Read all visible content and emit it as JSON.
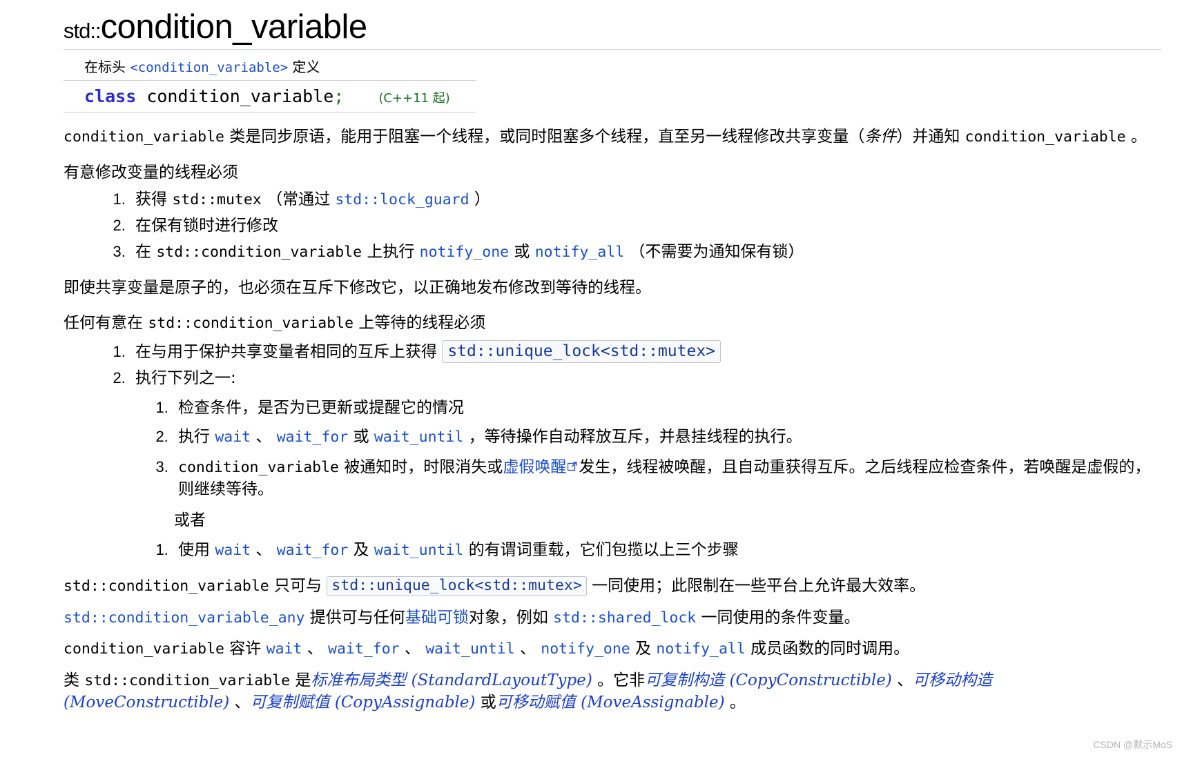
{
  "page": {
    "title_namespace": "std::",
    "title_name": "condition_variable"
  },
  "declaration": {
    "defined_in_prefix": "在标头 ",
    "header": "<condition_variable>",
    "defined_in_suffix": " 定义",
    "keyword": "class",
    "code_name": " condition_variable",
    "semicolon": ";",
    "since": "(C++11 起)"
  },
  "intro": {
    "p1_a": "condition_variable",
    "p1_b": " 类是同步原语，能用于阻塞一个线程，或同时阻塞多个线程，直至另一线程修改共享变量（",
    "p1_italic": "条件",
    "p1_c": "）并通知 ",
    "p1_d": "condition_variable",
    "p1_e": " 。",
    "p2": "有意修改变量的线程必须"
  },
  "modify_list": [
    {
      "pre": "获得 ",
      "code1": "std::mutex",
      "mid": " （常通过 ",
      "link1": "std::lock_guard",
      "post": " ）"
    },
    {
      "pre": "在保有锁时进行修改",
      "code1": "",
      "mid": "",
      "link1": "",
      "post": ""
    },
    {
      "pre": "在 ",
      "code1": "std::condition_variable",
      "mid": " 上执行 ",
      "link1": "notify_one",
      "mid2": " 或 ",
      "link2": "notify_all",
      "post": "  （不需要为通知保有锁）"
    }
  ],
  "mid_paras": {
    "p3": "即使共享变量是原子的，也必须在互斥下修改它，以正确地发布修改到等待的线程。",
    "p4_a": "任何有意在 ",
    "p4_code": "std::condition_variable",
    "p4_b": " 上等待的线程必须"
  },
  "wait_list": {
    "item1_text": "在与用于保护共享变量者相同的互斥上获得 ",
    "item1_boxed": "std::unique_lock<std::mutex>",
    "item2_text": "执行下列之一:",
    "sub_items": [
      {
        "text": "检查条件，是否为已更新或提醒它的情况"
      },
      {
        "pre": "执行 ",
        "link1": "wait",
        "sep1": " 、 ",
        "link2": "wait_for",
        "sep2": " 或 ",
        "link3": "wait_until",
        "post": " ，等待操作自动释放互斥，并悬挂线程的执行。"
      },
      {
        "pre": "condition_variable",
        "mid": " 被通知时，时限消失或",
        "link_text": "虚假唤醒",
        "post": "发生，线程被唤醒，且自动重获得互斥。之后线程应检查条件，若唤醒是虚假的，则继续等待。"
      }
    ],
    "or_label": "或者",
    "alt_items": [
      {
        "pre": "使用 ",
        "link1": "wait",
        "sep1": " 、 ",
        "link2": "wait_for",
        "sep2": " 及 ",
        "link3": "wait_until",
        "post": " 的有谓词重载，它们包揽以上三个步骤"
      }
    ]
  },
  "tail": {
    "p5_a": "std::condition_variable",
    "p5_b": " 只可与 ",
    "p5_boxed": "std::unique_lock<std::mutex>",
    "p5_c": " 一同使用；此限制在一些平台上允许最大效率。",
    "p6_link1": "std::condition_variable_any",
    "p6_a": " 提供可与任何",
    "p6_link2": "基础可锁",
    "p6_b": "对象，例如 ",
    "p6_link3": "std::shared_lock",
    "p6_c": " 一同使用的条件变量。",
    "p7_a": "condition_variable",
    "p7_b": " 容许 ",
    "p7_l1": "wait",
    "p7_s1": " 、 ",
    "p7_l2": "wait_for",
    "p7_s2": " 、 ",
    "p7_l3": "wait_until",
    "p7_s3": " 、 ",
    "p7_l4": "notify_one",
    "p7_s4": " 及 ",
    "p7_l5": "notify_all",
    "p7_c": " 成员函数的同时调用。",
    "p8_a": "类 ",
    "p8_code": "std::condition_variable",
    "p8_b": " 是",
    "p8_i1": "标准布局类型",
    "p8_i1en": " (StandardLayoutType)",
    "p8_c": " 。它非",
    "p8_i2": "可复制构造",
    "p8_i2en": " (CopyConstructible)",
    "p8_d": " 、",
    "p8_i3": "可移动构造",
    "p8_i3en": " (MoveConstructible)",
    "p8_e": " 、",
    "p8_i4": "可复制赋值",
    "p8_i4en": " (CopyAssignable)",
    "p8_f": " 或",
    "p8_i5": "可移动赋值",
    "p8_i5en": " (MoveAssignable)",
    "p8_g": " 。"
  },
  "watermark": "CSDN @默示MoS",
  "colors": {
    "link_blue": "#1a4fcd",
    "keyword_blue": "#2b2bd6",
    "since_green": "#1d7324",
    "box_bg": "#f8f9fa",
    "box_border": "#c0c4cb",
    "rule": "#c8ccd1"
  }
}
